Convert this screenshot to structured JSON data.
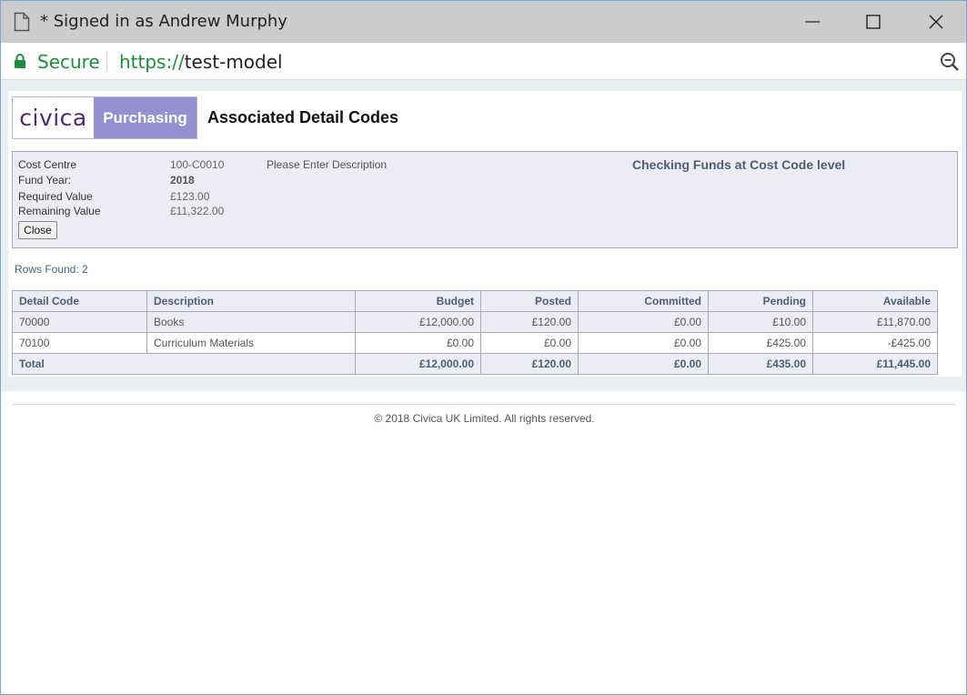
{
  "window": {
    "title": "* Signed in as Andrew Murphy"
  },
  "addressbar": {
    "secure_label": "Secure",
    "url_scheme": "https://",
    "url_host": "test-model"
  },
  "logo": {
    "brand": "civica",
    "product": "Purchasing"
  },
  "page": {
    "title": "Associated Detail Codes"
  },
  "info": {
    "cost_centre_label": "Cost Centre",
    "cost_centre_value": "100-C0010",
    "description": "Please Enter Description",
    "fund_year_label": "Fund Year:",
    "fund_year_value": "2018",
    "required_label": "Required Value",
    "required_value": "£123.00",
    "remaining_label": "Remaining Value",
    "remaining_value": "£11,322.00",
    "close_label": "Close",
    "check_message": "Checking Funds at Cost Code level"
  },
  "rows_found": "Rows Found: 2",
  "table": {
    "headers": [
      "Detail Code",
      "Description",
      "Budget",
      "Posted",
      "Committed",
      "Pending",
      "Available"
    ],
    "rows": [
      [
        "70000",
        "Books",
        "£12,000.00",
        "£120.00",
        "£0.00",
        "£10.00",
        "£11,870.00"
      ],
      [
        "70100",
        "Curriculum Materials",
        "£0.00",
        "£0.00",
        "£0.00",
        "£425.00",
        "-£425.00"
      ]
    ],
    "total": [
      "Total",
      "£12,000.00",
      "£120.00",
      "£0.00",
      "£435.00",
      "£11,445.00"
    ]
  },
  "footer": {
    "copyright": "© 2018 Civica UK Limited. All rights reserved."
  },
  "icons": {
    "document": "document-icon",
    "lock": "lock-icon",
    "zoom": "zoom-out-icon",
    "minimize": "minimize-icon",
    "maximize": "maximize-icon",
    "close": "close-icon"
  },
  "colors": {
    "secure_green": "#1e8e3e",
    "brand_purple": "#4b2d6e",
    "product_bg": "#9590cf",
    "panel_bg": "#ececf5",
    "heading_blue": "#4c6074"
  }
}
